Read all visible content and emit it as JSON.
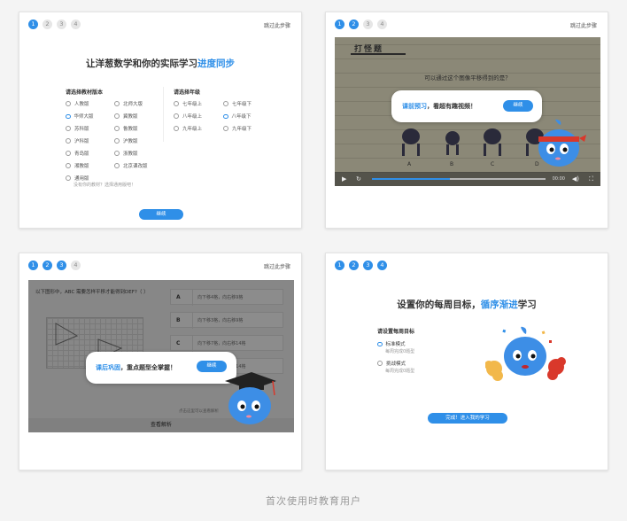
{
  "screens": [
    {
      "steps": [
        "1",
        "2",
        "3",
        "4"
      ],
      "active_step": 1,
      "skip_label": "跳过此步骤",
      "headline_pre": "让洋葱数学和你的实际学习",
      "headline_hl": "进度同步",
      "textbook": {
        "title": "请选择教材版本",
        "col1": [
          "人教版",
          "华师大版",
          "苏科版",
          "沪科版",
          "青岛版",
          "湘教版",
          "通用版"
        ],
        "col2": [
          "北师大版",
          "冀教版",
          "鲁教版",
          "沪教版",
          "浙教版",
          "北京课改版"
        ],
        "selected": "华师大版",
        "hint": "没有你的教材？选择通用版吧！"
      },
      "grade": {
        "title": "请选择年级",
        "col1": [
          "七年级上",
          "八年级上",
          "九年级上"
        ],
        "col2": [
          "七年级下",
          "八年级下",
          "九年级下"
        ],
        "selected": "八年级下"
      },
      "continue_label": "继续"
    },
    {
      "steps": [
        "1",
        "2",
        "3",
        "4"
      ],
      "active_step": 2,
      "skip_label": "跳过此步骤",
      "video": {
        "paper_title": "打怪题",
        "question": "可以通过这个图像平移得到的是？",
        "figure_labels": [
          "A",
          "B",
          "C",
          "D"
        ],
        "time": "00:00",
        "progress": 0.45
      },
      "bubble_hl": "课前预习",
      "bubble_text": "，看超有趣视频！",
      "continue_label": "继续"
    },
    {
      "steps": [
        "1",
        "2",
        "3",
        "4"
      ],
      "active_step": 3,
      "skip_label": "跳过此步骤",
      "question": "以下图形中，ABC 需要怎样平移才能得到DEF?（  ）",
      "answers": [
        {
          "key": "A",
          "text": "向下移4格，向右移9格"
        },
        {
          "key": "B",
          "text": "向下移3格，向右移9格"
        },
        {
          "key": "C",
          "text": "向下移7格，向右移14格"
        },
        {
          "key": "D",
          "text": "向下移2格，向右移14格"
        }
      ],
      "hint": "点击这里可以查看解析",
      "analysis_label": "查看解析",
      "bubble_hl": "课后巩固",
      "bubble_text": "，重点题型全掌握！",
      "continue_label": "继续"
    },
    {
      "steps": [
        "1",
        "2",
        "3",
        "4"
      ],
      "active_step": 4,
      "headline_pre": "设置你的每周目标，",
      "headline_hl": "循序渐进",
      "headline_post": "学习",
      "goal_title": "请设置每周目标",
      "goals": [
        {
          "label": "标准模式",
          "sub": "每周完成0题型",
          "selected": true
        },
        {
          "label": "挑战模式",
          "sub": "每周完成0题型",
          "selected": false
        }
      ],
      "finish_label": "完成！进入我的学习"
    }
  ],
  "caption": "首次使用时教育用户",
  "colors": {
    "accent": "#2f8fe8",
    "mascot": "#3d8ee6",
    "headband": "#d9382b"
  }
}
